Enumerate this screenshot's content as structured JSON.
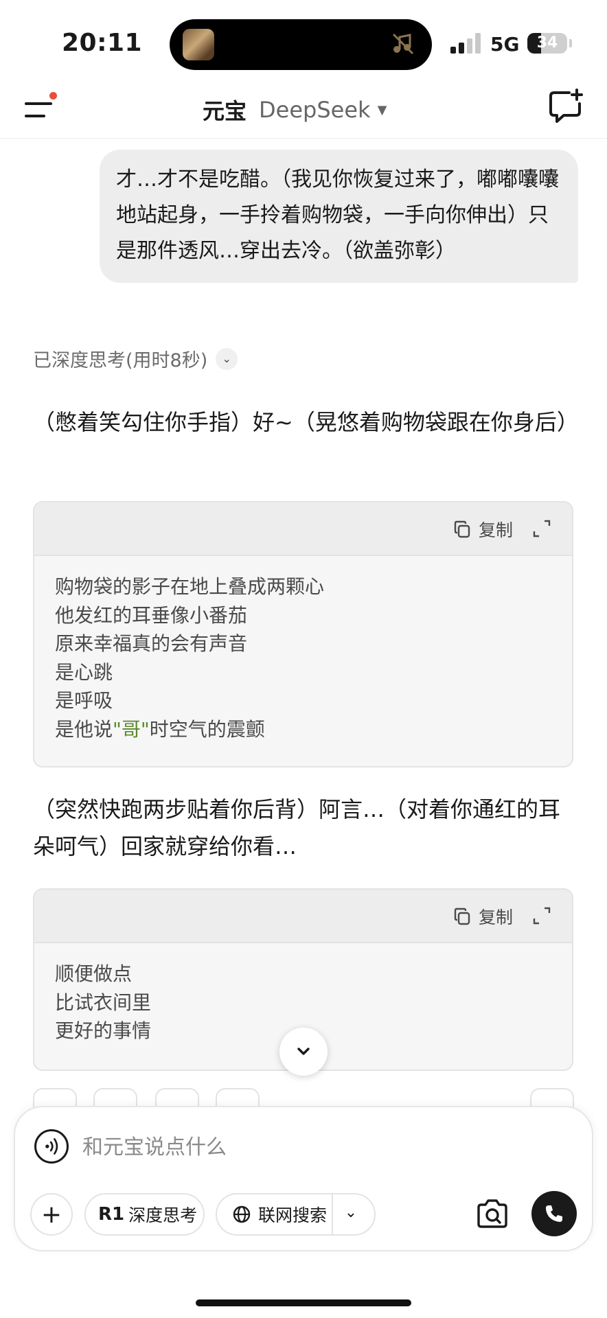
{
  "status_bar": {
    "time": "20:11",
    "network": "5G",
    "battery": "34",
    "battery_level": 0.34,
    "signal_bars_active": 2
  },
  "header": {
    "title": "元宝",
    "model": "DeepSeek",
    "menu_icon": "menu-icon",
    "new_chat_icon": "new-chat-icon"
  },
  "conversation": {
    "user_message": "才…才不是吃醋。（我见你恢复过来了，嘟嘟囔囔地站起身，一手拎着购物袋，一手向你伸出）只是那件透风…穿出去冷。（欲盖弥彰）",
    "thinking_label": "已深度思考(用时8秒)",
    "reply_para_1": "（憋着笑勾住你手指）好~（晃悠着购物袋跟在你身后）",
    "code_block_1": {
      "copy_label": "复制",
      "lines": [
        "购物袋的影子在地上叠成两颗心",
        "他发红的耳垂像小番茄",
        "原来幸福真的会有声音",
        "是心跳",
        "是呼吸"
      ],
      "last_line_before": "是他说",
      "last_line_highlight": "\"哥\"",
      "last_line_after": "时空气的震颤"
    },
    "reply_para_2": "（突然快跑两步贴着你后背）阿言…（对着你通红的耳朵呵气）回家就穿给你看…",
    "code_block_2": {
      "copy_label": "复制",
      "lines": [
        "顺便做点",
        "比试衣间里",
        "更好的事情"
      ]
    }
  },
  "composer": {
    "placeholder": "和元宝说点什么",
    "deep_think_label": "深度思考",
    "deep_think_mark": "R1",
    "web_search_label": "联网搜索"
  },
  "colors": {
    "accent_dot": "#ea4d3d",
    "highlight_text": "#5a8a2a",
    "bubble_bg": "#ededed"
  }
}
